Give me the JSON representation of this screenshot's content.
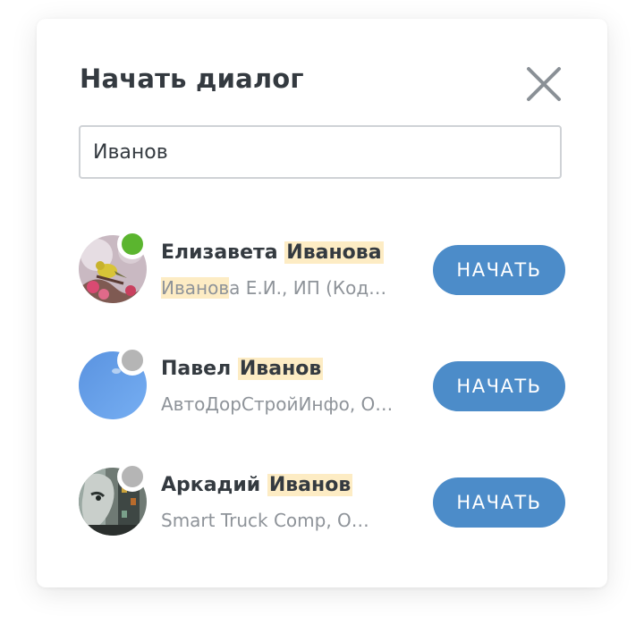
{
  "dialog": {
    "title": "Начать диалог",
    "close_icon": "close-icon"
  },
  "search": {
    "value": "Иванов"
  },
  "results": [
    {
      "name_first": "Елизавета",
      "name_last": "Иванова",
      "subtitle_highlight": "Иванов",
      "subtitle_rest": "а Е.И., ИП (Код…",
      "status": "online",
      "status_color": "#5bb52f",
      "button_label": "НАЧАТЬ",
      "avatar_icon": "bird-photo-avatar"
    },
    {
      "name_first": "Павел",
      "name_last": "Иванов",
      "subtitle": "АвтоДорСтройИнфо, О…",
      "status": "offline",
      "status_color": "#b5b5b5",
      "button_label": "НАЧАТЬ",
      "avatar_icon": "sky-photo-avatar"
    },
    {
      "name_first": "Аркадий",
      "name_last": "Иванов",
      "subtitle": "Smart Truck Comp, О…",
      "status": "offline",
      "status_color": "#b5b5b5",
      "button_label": "НАЧАТЬ",
      "avatar_icon": "street-art-photo-avatar"
    }
  ],
  "colors": {
    "accent": "#4c8cc9",
    "highlight": "#fdecc4",
    "title": "#343a40",
    "muted": "#8e9399"
  }
}
